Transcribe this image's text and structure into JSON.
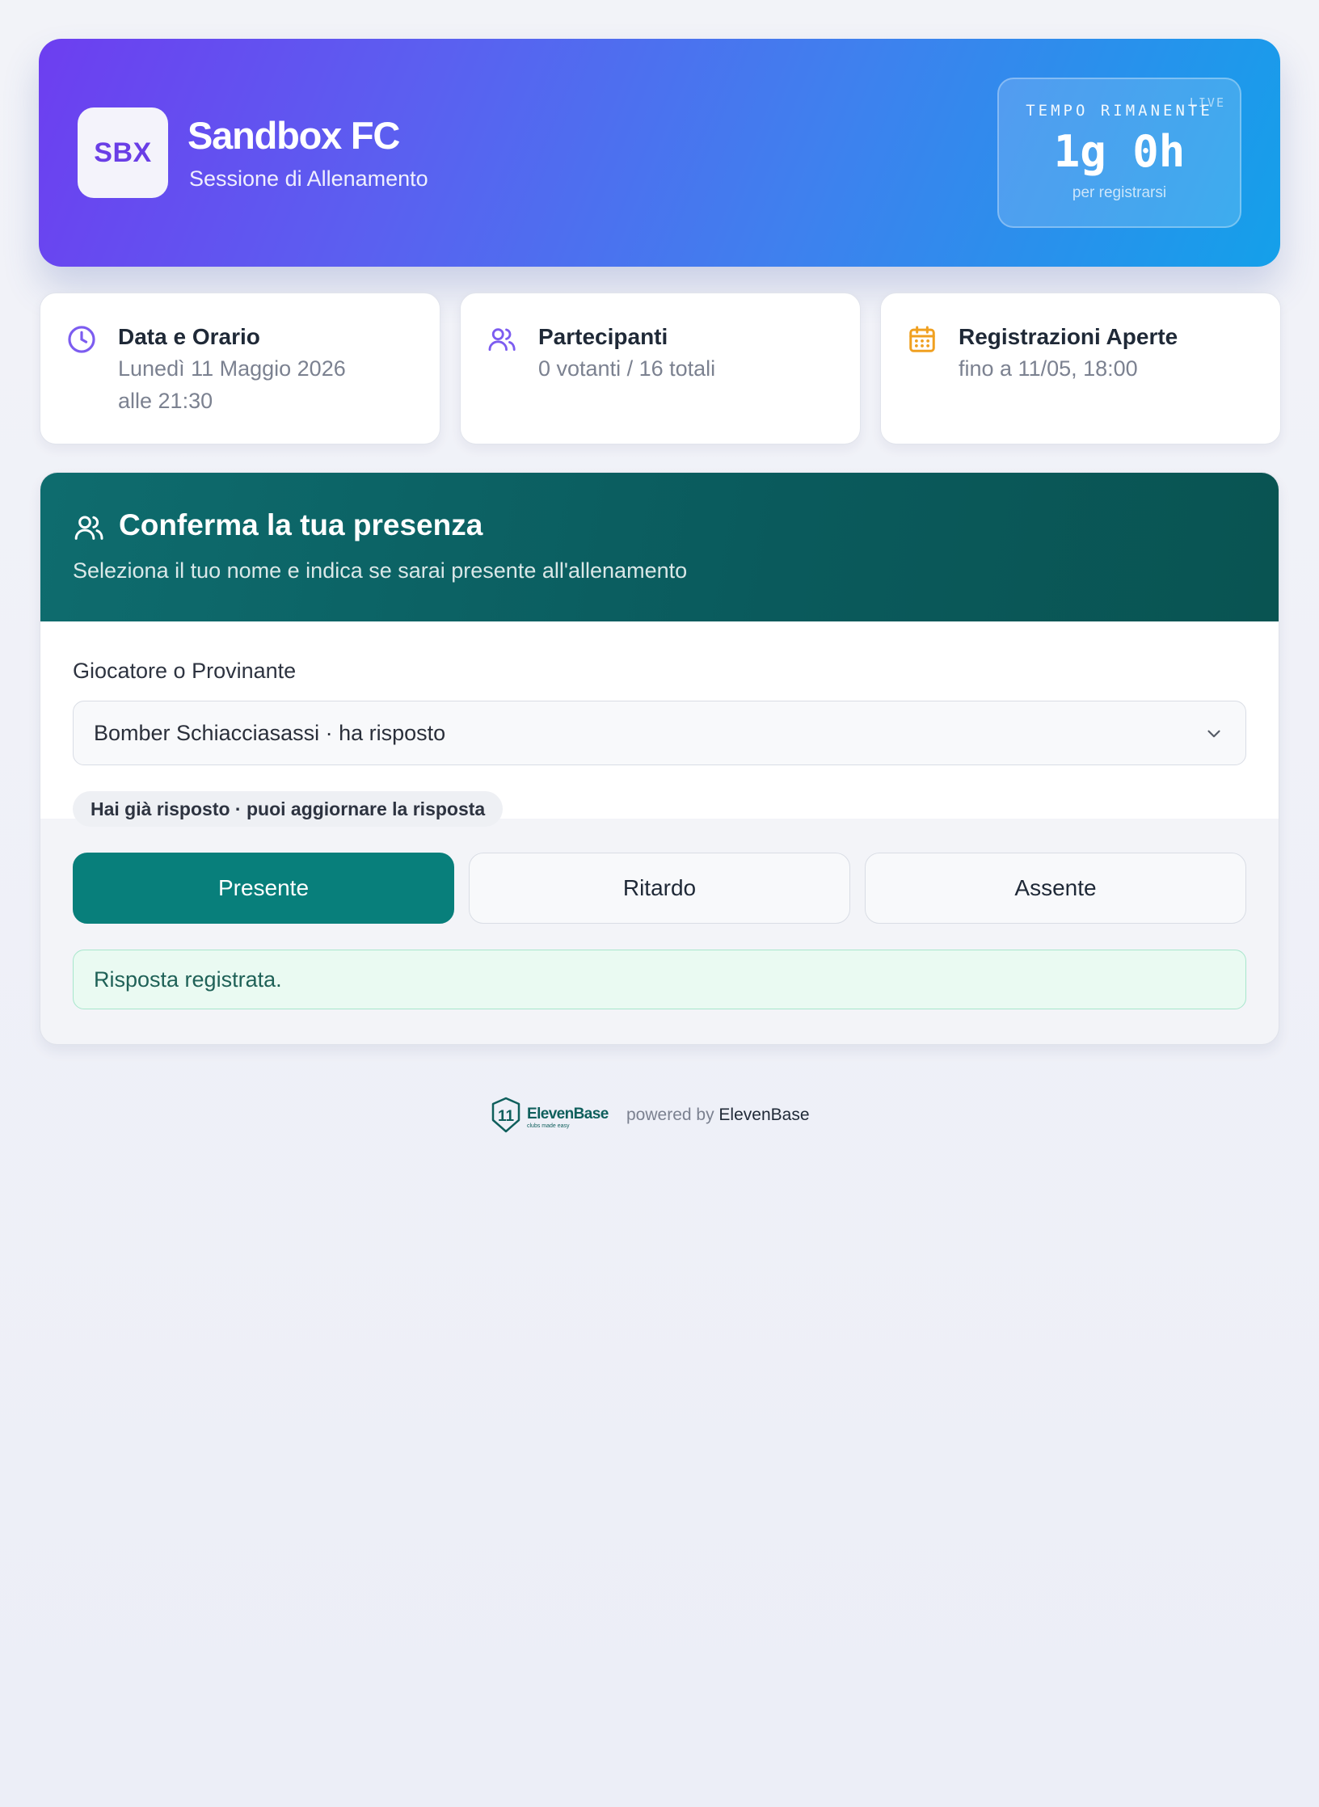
{
  "header": {
    "logo_text": "SBX",
    "club_name": "Sandbox FC",
    "session_type": "Sessione di Allenamento",
    "timer": {
      "label": "TEMPO RIMANENTE",
      "live": "LIVE",
      "value": "1g 0h",
      "subtitle": "per registrarsi"
    }
  },
  "info_cards": [
    {
      "icon": "clock-icon",
      "title": "Data e Orario",
      "line1": "Lunedì 11 Maggio 2026",
      "line2": "alle 21:30",
      "color": "#7c5cf0"
    },
    {
      "icon": "users-icon",
      "title": "Partecipanti",
      "line1": "0 votanti / 16 totali",
      "color": "#7c5cf0"
    },
    {
      "icon": "calendar-icon",
      "title": "Registrazioni Aperte",
      "line1": "fino a 11/05, 18:00",
      "color": "#f0a020"
    }
  ],
  "attendance": {
    "title": "Conferma la tua presenza",
    "subtitle": "Seleziona il tuo nome e indica se sarai presente all'allenamento",
    "field_label": "Giocatore o Provinante",
    "selected_player": "Bomber Schiacciasassi · ha risposto",
    "status_pill": "Hai già risposto · puoi aggiornare la risposta",
    "buttons": {
      "present": "Presente",
      "late": "Ritardo",
      "absent": "Assente"
    },
    "selected_option": "Presente",
    "success_message": "Risposta registrata."
  },
  "footer": {
    "logo_name": "ElevenBase",
    "logo_tagline": "clubs made easy",
    "powered_by": "powered by",
    "brand": "ElevenBase"
  },
  "colors": {
    "accent_teal": "#087f7b",
    "header_purple": "#6d3ef0",
    "header_blue": "#14a0ea"
  }
}
